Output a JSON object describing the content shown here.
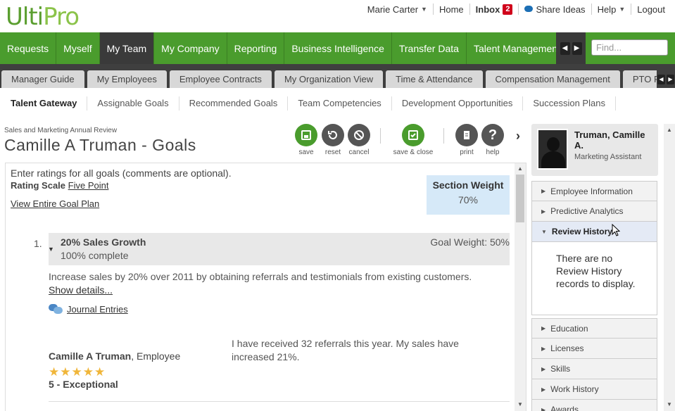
{
  "brand": {
    "logo_part1": "Ulti",
    "logo_part2": "Pro"
  },
  "topnav": {
    "user": "Marie Carter",
    "home": "Home",
    "inbox": "Inbox",
    "inbox_count": "2",
    "share_ideas": "Share Ideas",
    "help": "Help",
    "logout": "Logout"
  },
  "mainnav": {
    "tabs": [
      "Requests",
      "Myself",
      "My Team",
      "My Company",
      "Reporting",
      "Business Intelligence",
      "Transfer Data",
      "Talent Management"
    ],
    "active": "My Team",
    "find_placeholder": "Find..."
  },
  "subnav": {
    "tabs": [
      "Manager Guide",
      "My Employees",
      "Employee Contracts",
      "My Organization View",
      "Time & Attendance",
      "Compensation Management",
      "PTO Reque"
    ]
  },
  "tertiary": {
    "tabs": [
      "Talent Gateway",
      "Assignable Goals",
      "Recommended Goals",
      "Team Competencies",
      "Development Opportunities",
      "Succession Plans"
    ],
    "active": "Talent Gateway"
  },
  "page": {
    "breadcrumb": "Sales and Marketing Annual Review",
    "title": "Camille A Truman - Goals"
  },
  "toolbar": {
    "save": "save",
    "reset": "reset",
    "cancel": "cancel",
    "save_close": "save & close",
    "print": "print",
    "help": "help"
  },
  "content": {
    "instructions": "Enter ratings for all goals (comments are optional).",
    "rating_scale_label": "Rating Scale",
    "rating_scale_value": "Five Point",
    "view_plan": "View Entire Goal Plan",
    "section_weight_label": "Section Weight",
    "section_weight_value": "70%"
  },
  "goal": {
    "number": "1.",
    "name": "20% Sales Growth",
    "complete": "100% complete",
    "weight": "Goal Weight: 50%",
    "description": "Increase sales by 20% over 2011 by obtaining referrals and testimonials from existing customers.",
    "show_details": "Show details...",
    "journal": "Journal Entries",
    "rater_name": "Camille A Truman",
    "rater_role": ", Employee",
    "comment": "I have received 32 referrals this year. My sales have increased 21%.",
    "rating": "5 - Exceptional",
    "stars": 5
  },
  "profile": {
    "name": "Truman, Camille A.",
    "title": "Marketing Assistant"
  },
  "accordion": {
    "items": [
      "Employee Information",
      "Predictive Analytics",
      "Review History",
      "Education",
      "Licenses",
      "Skills",
      "Work History",
      "Awards"
    ],
    "open": "Review History",
    "empty_message": "There are no Review History records to display."
  },
  "colors": {
    "brand_green": "#4a9c2d",
    "dark_nav": "#3a3a3a",
    "section_weight_bg": "#d6e9f8",
    "star": "#f0b63a",
    "inbox_badge": "#d0021b"
  }
}
